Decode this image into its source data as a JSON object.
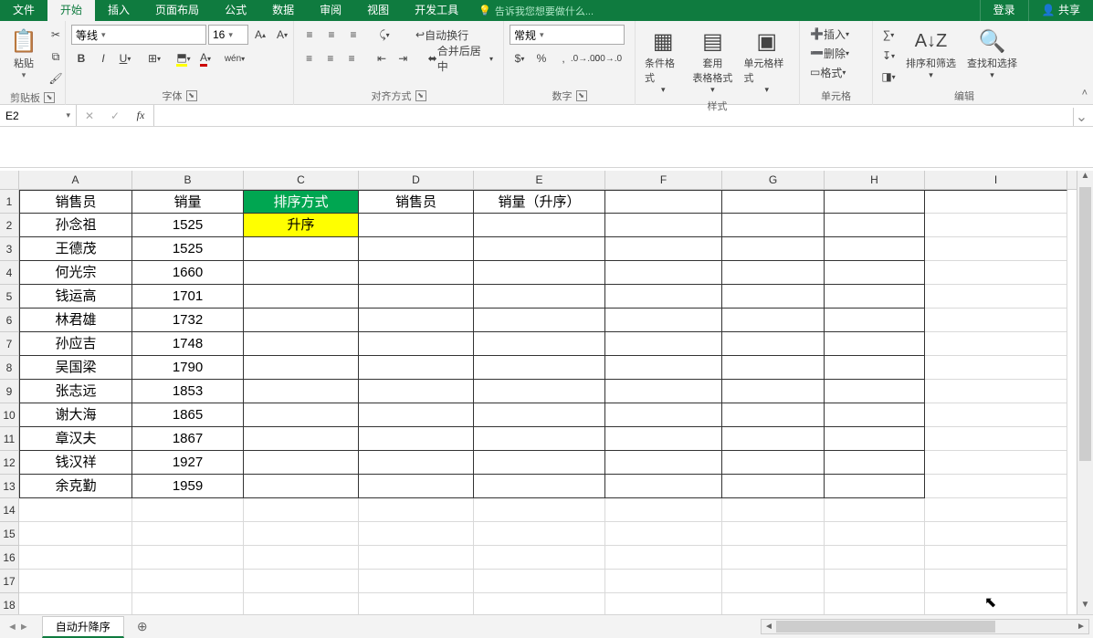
{
  "tabs": {
    "file": "文件",
    "home": "开始",
    "insert": "插入",
    "page": "页面布局",
    "formulas": "公式",
    "data": "数据",
    "review": "审阅",
    "view": "视图",
    "dev": "开发工具",
    "tell_me": "告诉我您想要做什么...",
    "login": "登录",
    "share": "共享"
  },
  "ribbon": {
    "clipboard": {
      "paste": "粘贴",
      "label": "剪贴板"
    },
    "font": {
      "name": "等线",
      "size": "16",
      "label": "字体"
    },
    "align": {
      "wrap": "自动换行",
      "merge": "合并后居中",
      "label": "对齐方式"
    },
    "number": {
      "format": "常规",
      "label": "数字"
    },
    "styles": {
      "cond": "条件格式",
      "table": "套用\n表格格式",
      "cell": "单元格样式",
      "label": "样式"
    },
    "cells": {
      "insert": "插入",
      "delete": "删除",
      "format": "格式",
      "label": "单元格"
    },
    "editing": {
      "sort": "排序和筛选",
      "find": "查找和选择",
      "label": "编辑"
    }
  },
  "name_box": "E2",
  "columns": [
    "A",
    "B",
    "C",
    "D",
    "E",
    "F",
    "G",
    "H",
    "I"
  ],
  "rows": [
    "1",
    "2",
    "3",
    "4",
    "5",
    "6",
    "7",
    "8",
    "9",
    "10",
    "11",
    "12",
    "13",
    "14",
    "15",
    "16",
    "17",
    "18"
  ],
  "data": {
    "header": [
      "销售员",
      "销量",
      "排序方式",
      "销售员",
      "销量（升序）"
    ],
    "c2": "升序",
    "body": [
      {
        "a": "孙念祖",
        "b": "1525"
      },
      {
        "a": "王德茂",
        "b": "1525"
      },
      {
        "a": "何光宗",
        "b": "1660"
      },
      {
        "a": "钱运高",
        "b": "1701"
      },
      {
        "a": "林君雄",
        "b": "1732"
      },
      {
        "a": "孙应吉",
        "b": "1748"
      },
      {
        "a": "吴国梁",
        "b": "1790"
      },
      {
        "a": "张志远",
        "b": "1853"
      },
      {
        "a": "谢大海",
        "b": "1865"
      },
      {
        "a": "章汉夫",
        "b": "1867"
      },
      {
        "a": "钱汉祥",
        "b": "1927"
      },
      {
        "a": "余克勤",
        "b": "1959"
      }
    ]
  },
  "sheet": {
    "name": "自动升降序"
  }
}
